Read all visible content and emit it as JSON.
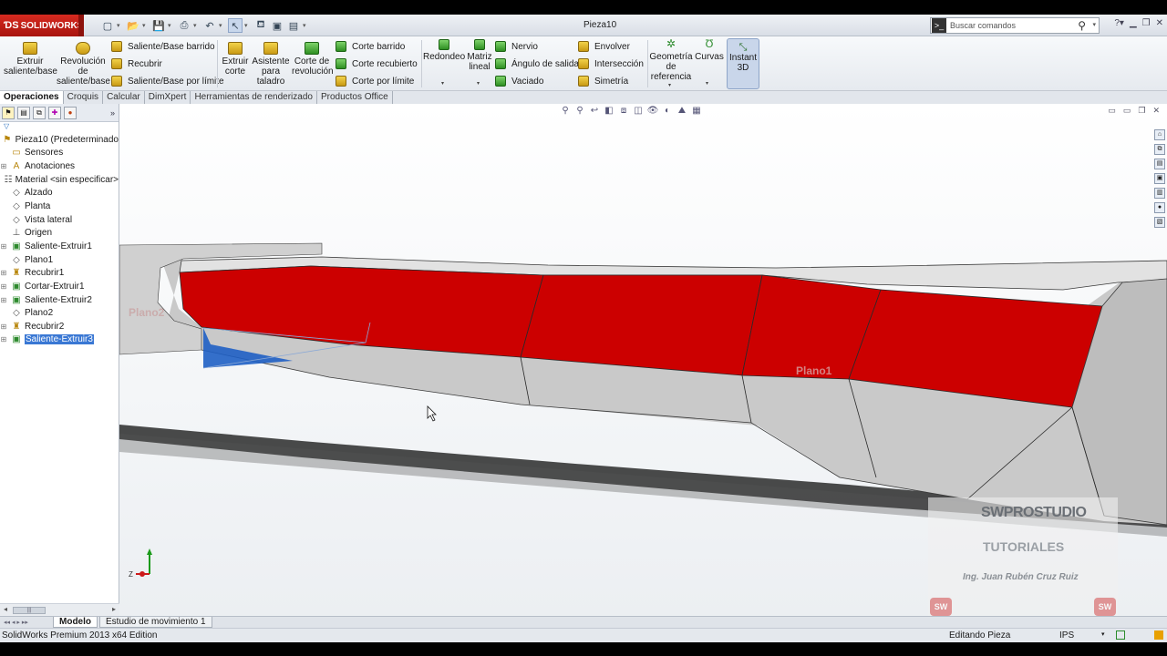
{
  "app": {
    "logo": "SOLIDWORKS",
    "document_title": "Pieza10",
    "search_placeholder": "Buscar comandos"
  },
  "ribbon": {
    "extruir_saliente": "Extruir saliente/base",
    "revolucion_saliente": "Revolución de saliente/base",
    "saliente_barrido": "Saliente/Base barrido",
    "recubrir": "Recubrir",
    "saliente_limite": "Saliente/Base por límite",
    "extruir_corte": "Extruir corte",
    "asistente_taladro": "Asistente para taladro",
    "corte_revolucion": "Corte de revolución",
    "corte_barrido": "Corte barrido",
    "corte_recubierto": "Corte recubierto",
    "corte_limite": "Corte por límite",
    "redondeo": "Redondeo",
    "matriz_lineal": "Matriz lineal",
    "nervio": "Nervio",
    "angulo_salida": "Ángulo de salida",
    "vaciado": "Vaciado",
    "envolver": "Envolver",
    "interseccion": "Intersección",
    "simetria": "Simetría",
    "geometria_referencia": "Geometría de referencia",
    "curvas": "Curvas",
    "instant3d": "Instant 3D"
  },
  "tabs": [
    "Operaciones",
    "Croquis",
    "Calcular",
    "DimXpert",
    "Herramientas de renderizado",
    "Productos Office"
  ],
  "feature_tree": [
    {
      "label": "Pieza10  (Predeterminado",
      "icon": "part-icon",
      "root": true
    },
    {
      "label": "Sensores",
      "icon": "sensor-folder-icon"
    },
    {
      "label": "Anotaciones",
      "icon": "annotations-icon",
      "expand": true
    },
    {
      "label": "Material <sin especificar>",
      "icon": "material-icon"
    },
    {
      "label": "Alzado",
      "icon": "plane-icon"
    },
    {
      "label": "Planta",
      "icon": "plane-icon"
    },
    {
      "label": "Vista lateral",
      "icon": "plane-icon"
    },
    {
      "label": "Origen",
      "icon": "origin-icon"
    },
    {
      "label": "Saliente-Extruir1",
      "icon": "extrude-icon",
      "expand": true
    },
    {
      "label": "Plano1",
      "icon": "plane-icon"
    },
    {
      "label": "Recubrir1",
      "icon": "loft-icon",
      "expand": true
    },
    {
      "label": "Cortar-Extruir1",
      "icon": "cut-extrude-icon",
      "expand": true
    },
    {
      "label": "Saliente-Extruir2",
      "icon": "extrude-icon",
      "expand": true
    },
    {
      "label": "Plano2",
      "icon": "plane-icon"
    },
    {
      "label": "Recubrir2",
      "icon": "loft-icon",
      "expand": true
    },
    {
      "label": "Saliente-Extruir3",
      "icon": "extrude-icon",
      "expand": true,
      "selected": true
    }
  ],
  "viewport": {
    "plane_label_1": "Plano2",
    "plane_label_2": "Plano1",
    "triad_axis": "Z"
  },
  "watermark": {
    "title": "SWPROSTUDIO",
    "tutoriales": "TUTORIALES",
    "author": "Ing. Juan Rubén Cruz Ruiz"
  },
  "bottom_tabs": [
    "Modelo",
    "Estudio de movimiento 1"
  ],
  "status": {
    "edition": "SolidWorks Premium 2013 x64 Edition",
    "mode": "Editando Pieza",
    "units": "IPS"
  },
  "colors": {
    "face_red": "#cc0000",
    "body_gray": "#c8c8c8",
    "selection_blue": "#1f5fc4"
  }
}
